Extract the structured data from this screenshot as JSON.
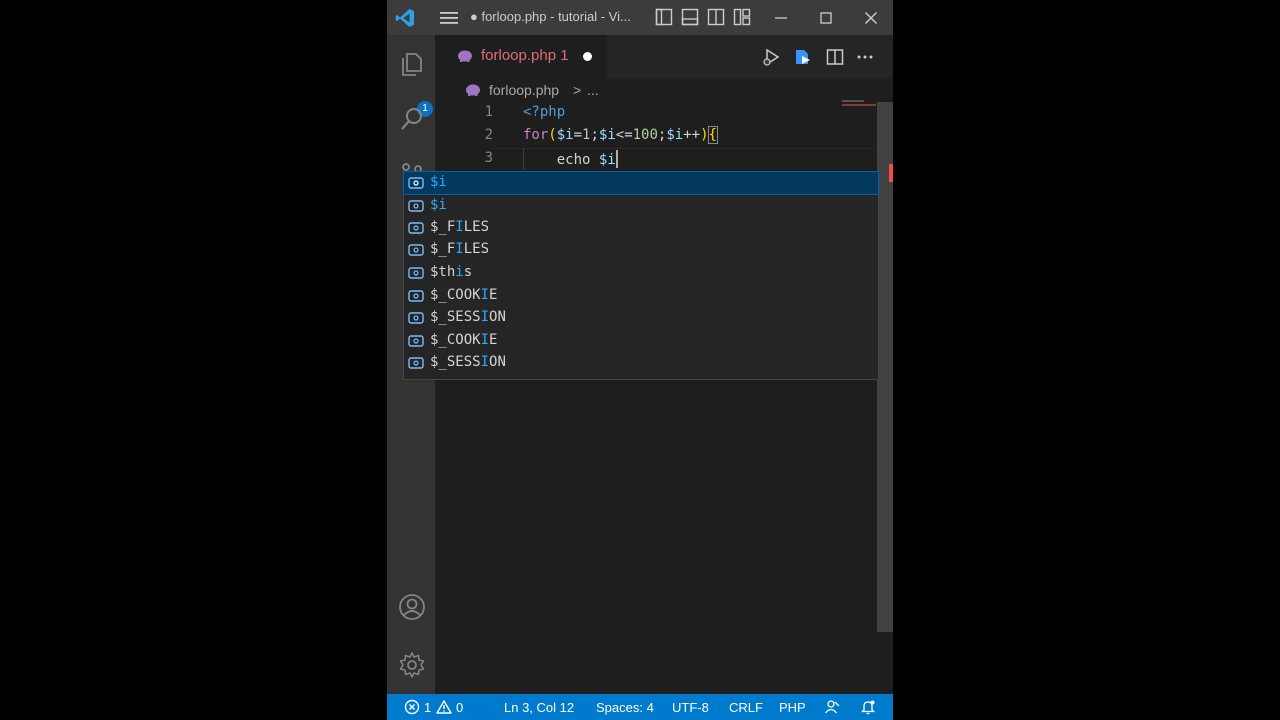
{
  "titlebar": {
    "title": "● forloop.php - tutorial - Vi..."
  },
  "activity": {
    "explorer_badge": "1"
  },
  "tab": {
    "name": "forloop.php",
    "problems": "1"
  },
  "breadcrumb": {
    "file": "forloop.php",
    "separator": ">",
    "more": "..."
  },
  "editor": {
    "line_numbers": [
      "1",
      "2",
      "3"
    ],
    "line1": {
      "open": "<?",
      "php": "php"
    },
    "line2": {
      "for": "for",
      "p1": "(",
      "v1": "$i",
      "eq": "=",
      "n1": "1",
      "s1": ";",
      "v2": "$i",
      "le": "<=",
      "n2": "100",
      "s2": ";",
      "v3": "$i",
      "inc": "++",
      "p2": ")",
      "brace": "{"
    },
    "line3": {
      "indent": "    ",
      "echo": "echo",
      "sp": " ",
      "var": "$i"
    }
  },
  "suggestions": [
    {
      "hl": "$i",
      "rest": "",
      "selected": true
    },
    {
      "hl": "$i",
      "rest": ""
    },
    {
      "pre": "$_F",
      "hl": "I",
      "post": "LES"
    },
    {
      "pre": "$_F",
      "hl": "I",
      "post": "LES"
    },
    {
      "pre": "$th",
      "hl": "i",
      "post": "s"
    },
    {
      "pre": "$_COOK",
      "hl": "I",
      "post": "E"
    },
    {
      "pre": "$_SESS",
      "hl": "I",
      "post": "ON"
    },
    {
      "pre": "$_COOK",
      "hl": "I",
      "post": "E"
    },
    {
      "pre": "$_SESS",
      "hl": "I",
      "post": "ON"
    }
  ],
  "status": {
    "errors": "1",
    "warnings": "0",
    "position": "Ln 3, Col 12",
    "spaces": "Spaces: 4",
    "encoding": "UTF-8",
    "eol": "CRLF",
    "language": "PHP"
  },
  "colors": {
    "accent": "#007acc",
    "tab_text": "#e06c75",
    "suggest_selected": "#04395e"
  }
}
